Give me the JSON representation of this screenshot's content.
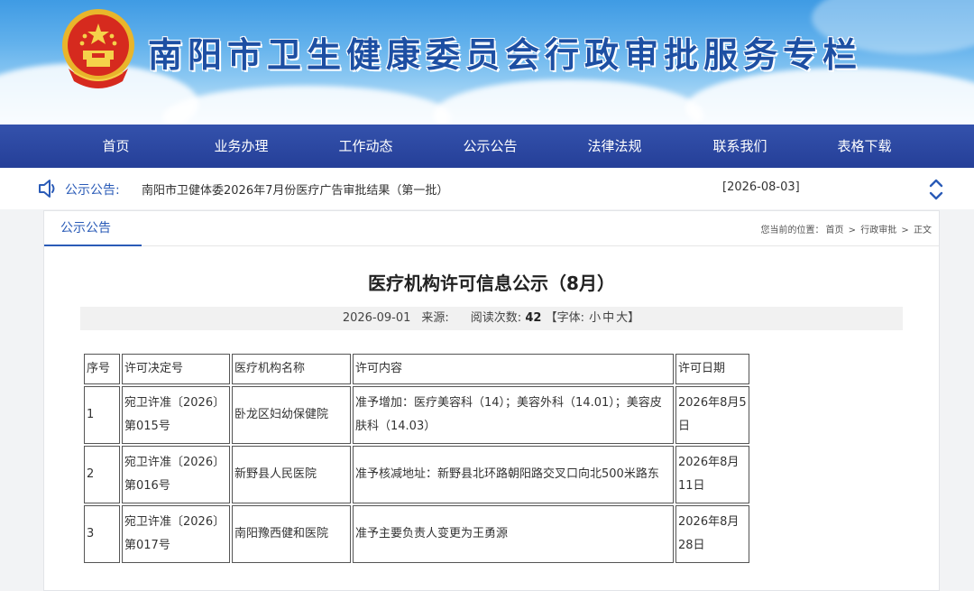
{
  "header": {
    "site_title": "南阳市卫生健康委员会行政审批服务专栏"
  },
  "nav": {
    "items": [
      "首页",
      "业务办理",
      "工作动态",
      "公示公告",
      "法律法规",
      "联系我们",
      "表格下载"
    ]
  },
  "notice": {
    "label": "公示公告:",
    "title": "南阳市卫健体委2026年7月份医疗广告审批结果（第一批）",
    "date": "[2026-08-03]"
  },
  "panel": {
    "tab_label": "公示公告",
    "breadcrumb": {
      "prefix": "您当前的位置：",
      "items": [
        "首页",
        "行政审批",
        "正文"
      ],
      "separator": ">"
    }
  },
  "article": {
    "title": "医疗机构许可信息公示（8月）",
    "date": "2026-09-01",
    "source_label": "来源:",
    "read_label": "阅读次数:",
    "read_count": "42",
    "font_label": "【字体:",
    "font_small": "小",
    "font_medium": "中",
    "font_large": "大】"
  },
  "table": {
    "headers": [
      "序号",
      "许可决定号",
      "医疗机构名称",
      "许可内容",
      "许可日期"
    ],
    "rows": [
      [
        "1",
        "宛卫许准〔2026〕第015号",
        "卧龙区妇幼保健院",
        "准予增加：医疗美容科（14）；美容外科（14.01）；美容皮肤科（14.03）",
        "2026年8月5日"
      ],
      [
        "2",
        "宛卫许准〔2026〕第016号",
        "新野县人民医院",
        "准予核减地址：新野县北环路朝阳路交叉口向北500米路东",
        "2026年8月11日"
      ],
      [
        "3",
        "宛卫许准〔2026〕第017号",
        "南阳豫西健和医院",
        "准予主要负责人变更为王勇源",
        "2026年8月28日"
      ]
    ]
  },
  "colors": {
    "nav_bg": "#2a449c",
    "accent": "#2a5bb7",
    "title_text": "#1d4fa3"
  },
  "icons": {
    "emblem": "national-emblem",
    "notice": "speaker-icon",
    "arrows": "up-down-chevron-icon"
  }
}
